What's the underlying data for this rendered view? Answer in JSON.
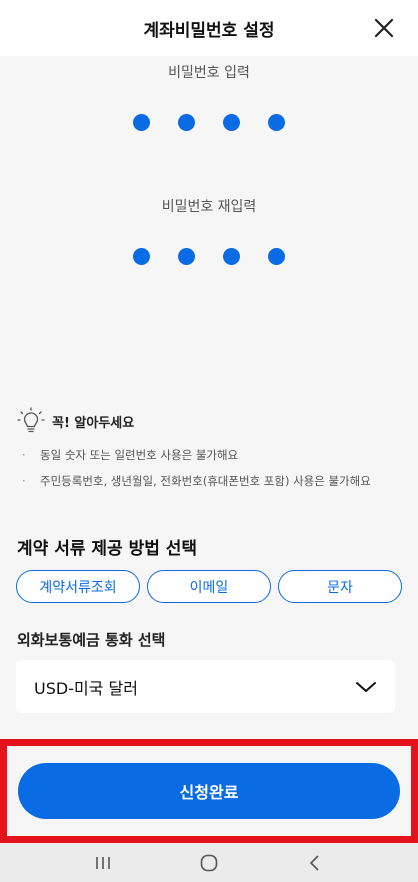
{
  "header": {
    "title": "계좌비밀번호 설정",
    "close_icon": "close-icon"
  },
  "password": {
    "label": "비밀번호 입력",
    "dots": 4
  },
  "password_confirm": {
    "label": "비밀번호 재입력",
    "dots": 4
  },
  "notice": {
    "icon": "lightbulb-icon",
    "title": "꼭! 알아두세요",
    "items": [
      "동일 숫자 또는 일련번호 사용은 불가해요",
      "주민등록번호, 생년월일, 전화번호(휴대폰번호 포함) 사용은 불가해요"
    ]
  },
  "doc_delivery": {
    "title": "계약 서류 제공 방법 선택",
    "options": [
      "계약서류조회",
      "이메일",
      "문자"
    ]
  },
  "currency": {
    "title": "외화보통예금 통화 선택",
    "selected": "USD-미국 달러"
  },
  "submit": {
    "label": "신청완료"
  },
  "navbar": {
    "icons": [
      "recent-apps-icon",
      "home-icon",
      "back-icon"
    ]
  },
  "colors": {
    "accent": "#0a6ce5",
    "highlight": "#e3141b",
    "background": "#f6f6f7"
  }
}
